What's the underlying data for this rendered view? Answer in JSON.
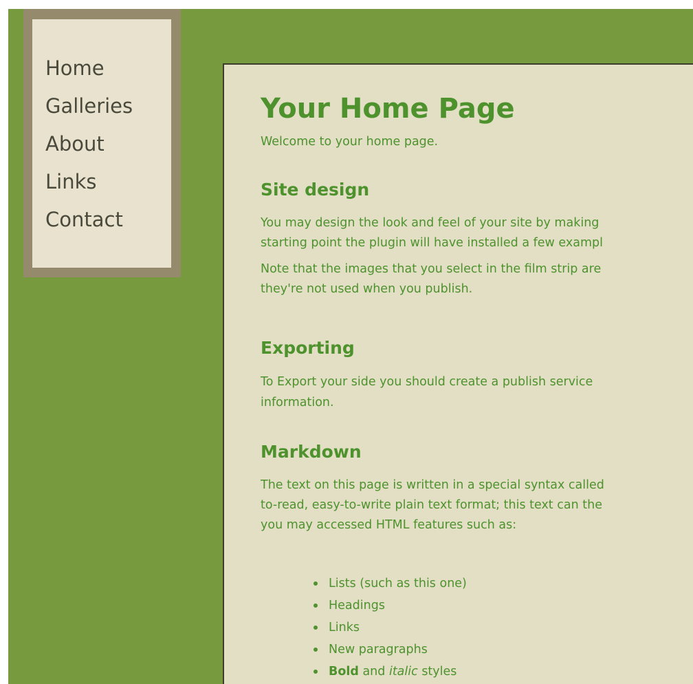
{
  "nav": {
    "items": [
      "Home",
      "Galleries",
      "About",
      "Links",
      "Contact"
    ]
  },
  "content": {
    "title": "Your Home Page",
    "welcome": "Welcome to your home page.",
    "sections": {
      "site_design": {
        "heading": "Site design",
        "para1_line1": "You may design the look and feel of your site by making",
        "para1_line2": "starting point the plugin will have installed a few exampl",
        "para2_line1": "Note that the images that you select in the film strip are",
        "para2_line2": "they're not used when you publish."
      },
      "exporting": {
        "heading": "Exporting",
        "line1": "To Export your side you should create a publish service",
        "line2": "information."
      },
      "markdown": {
        "heading": "Markdown",
        "line1": "The text on this page is written in a special syntax called",
        "line2": "to-read, easy-to-write plain text format; this text can the",
        "line3": "you may accessed HTML features such as:",
        "bullets": {
          "b1": "Lists (such as this one)",
          "b2": "Headings",
          "b3": "Links",
          "b4": "New paragraphs",
          "b5_bold": "Bold",
          "b5_and": " and ",
          "b5_italic": "italic",
          "b5_rest": " styles"
        }
      }
    }
  },
  "colors": {
    "background": "#779a3f",
    "nav_frame": "#958a6c",
    "nav_panel": "#e8e2cf",
    "content_panel": "#e2dfc4",
    "text_green": "#4e922e"
  }
}
